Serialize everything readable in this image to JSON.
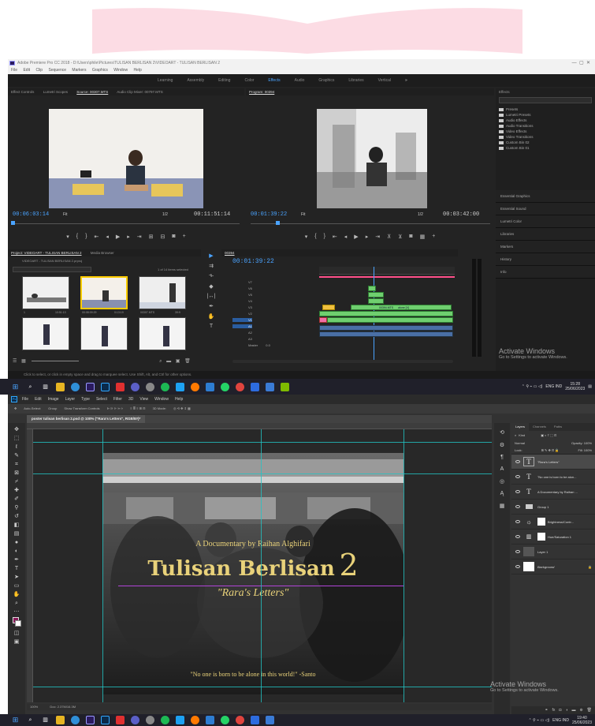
{
  "premiere": {
    "title": "Adobe Premiere Pro CC 2018 - D:\\Users\\phile\\Pictures\\TULISAN BERLISAN 2\\VIDEOART - TULISAN BERLISAN 2",
    "menu": [
      "File",
      "Edit",
      "Clip",
      "Sequence",
      "Markers",
      "Graphics",
      "Window",
      "Help"
    ],
    "workspaces": [
      "Learning",
      "Assembly",
      "Editing",
      "Color",
      "Effects",
      "Audio",
      "Graphics",
      "Libraries",
      "Vertical"
    ],
    "active_workspace": "Effects",
    "source_tabs": [
      "Effect Controls",
      "Lumetri Scopes",
      "Source: 00307.MTS",
      "Audio Clip Mixer: 00797.MTS"
    ],
    "source_timecode": "00:06:03:14",
    "source_fit": "Fit",
    "source_fraction": "1/2",
    "source_duration": "00:11:51:14",
    "program_tab": "Program: 00394",
    "program_timecode": "00:01:39:22",
    "program_fit": "Fit",
    "program_fraction": "1/2",
    "program_duration": "00:03:42:00",
    "effects": {
      "title": "Effects",
      "items": [
        "Presets",
        "Lumetri Presets",
        "Audio Effects",
        "Audio Transitions",
        "Video Effects",
        "Video Transitions",
        "Custom Bin 02",
        "Custom Bin 01"
      ],
      "sections": [
        "Essential Graphics",
        "Essential Sound",
        "Lumetri Color",
        "Libraries",
        "Markers",
        "History",
        "Info"
      ]
    },
    "project": {
      "tabs": [
        "Project: VIDEOART - TULISAN BERLISAN 2",
        "Media Browser"
      ],
      "path": "VIDEOART - TULISAN BERLISAN 2.prproj",
      "selection": "1 of 14 items selected",
      "thumb_captions": [
        "1",
        "10:51:13",
        "00:08:09:29",
        "0:13:19",
        "00307.MTS",
        "39:9"
      ]
    },
    "timeline": {
      "tab": "00394",
      "timecode": "00:01:39:22",
      "tracks": [
        "V7",
        "V6",
        "V5",
        "V4",
        "V3",
        "V2",
        "V1",
        "A1",
        "A2",
        "A3",
        "Master"
      ],
      "master_value": "0.0",
      "clip_labels": [
        "00394.MTS",
        "alone [V]"
      ]
    },
    "status": "Click to select, or click in empty space and drag to marquee select. Use Shift, Alt, and Ctrl for other options.",
    "activate_title": "Activate Windows",
    "activate_sub": "Go to Settings to activate Windows."
  },
  "taskbar_top": {
    "tray_text": "ENG IND",
    "time": "15:28",
    "date": "25/06/2023"
  },
  "photoshop": {
    "menu": [
      "File",
      "Edit",
      "Image",
      "Layer",
      "Type",
      "Select",
      "Filter",
      "3D",
      "View",
      "Window",
      "Help"
    ],
    "options": [
      "Auto-Select:",
      "Group",
      "Show Transform Controls",
      "3D Mode:"
    ],
    "doc_tab": "poster tulisan berlisan 2.psd @ 100% (\"Rara's Letters\", RGB/8#)*",
    "zoom": "100%",
    "doc_info": "Doc: 2.37M/16.3M",
    "poster": {
      "subtitle": "A Documentary by Raihan Alghifari",
      "title": "Tulisan Berlisan",
      "title_num": "2",
      "tagline": "\"Rara's Letters\"",
      "quote": "\"No one is born to be alone in this world!\" -Santo"
    },
    "layers": {
      "tabs": [
        "Layers",
        "Channels",
        "Paths"
      ],
      "kind": "Kind",
      "blend": "Normal",
      "opacity": "Opacity: 100%",
      "lock": "Lock:",
      "fill": "Fill: 100%",
      "rows": [
        {
          "type": "T",
          "name": "\"Rara's Letters\"",
          "selected": true
        },
        {
          "type": "T",
          "name": "\"No one is born to be alon..."
        },
        {
          "type": "T",
          "name": "A Documentary by Raihan ..."
        },
        {
          "type": "group",
          "name": "Group 1"
        },
        {
          "type": "adj",
          "name": "Brightness/Contr..."
        },
        {
          "type": "adj",
          "name": "Hue/Saturation 1"
        },
        {
          "type": "img",
          "name": "Layer 1"
        },
        {
          "type": "bg",
          "name": "Background"
        }
      ]
    },
    "activate_title": "Activate Windows",
    "activate_sub": "Go to Settings to activate Windows."
  },
  "taskbar_bottom": {
    "tray_text": "ENG IND",
    "time": "19:40",
    "date": "25/06/2023"
  },
  "colors": {
    "accent_blue": "#4aa3ff",
    "ps_blue": "#31a8ff",
    "poster_gold": "#e9d27a",
    "guide": "#22c4c4",
    "book_pink": "#fcdce4"
  }
}
